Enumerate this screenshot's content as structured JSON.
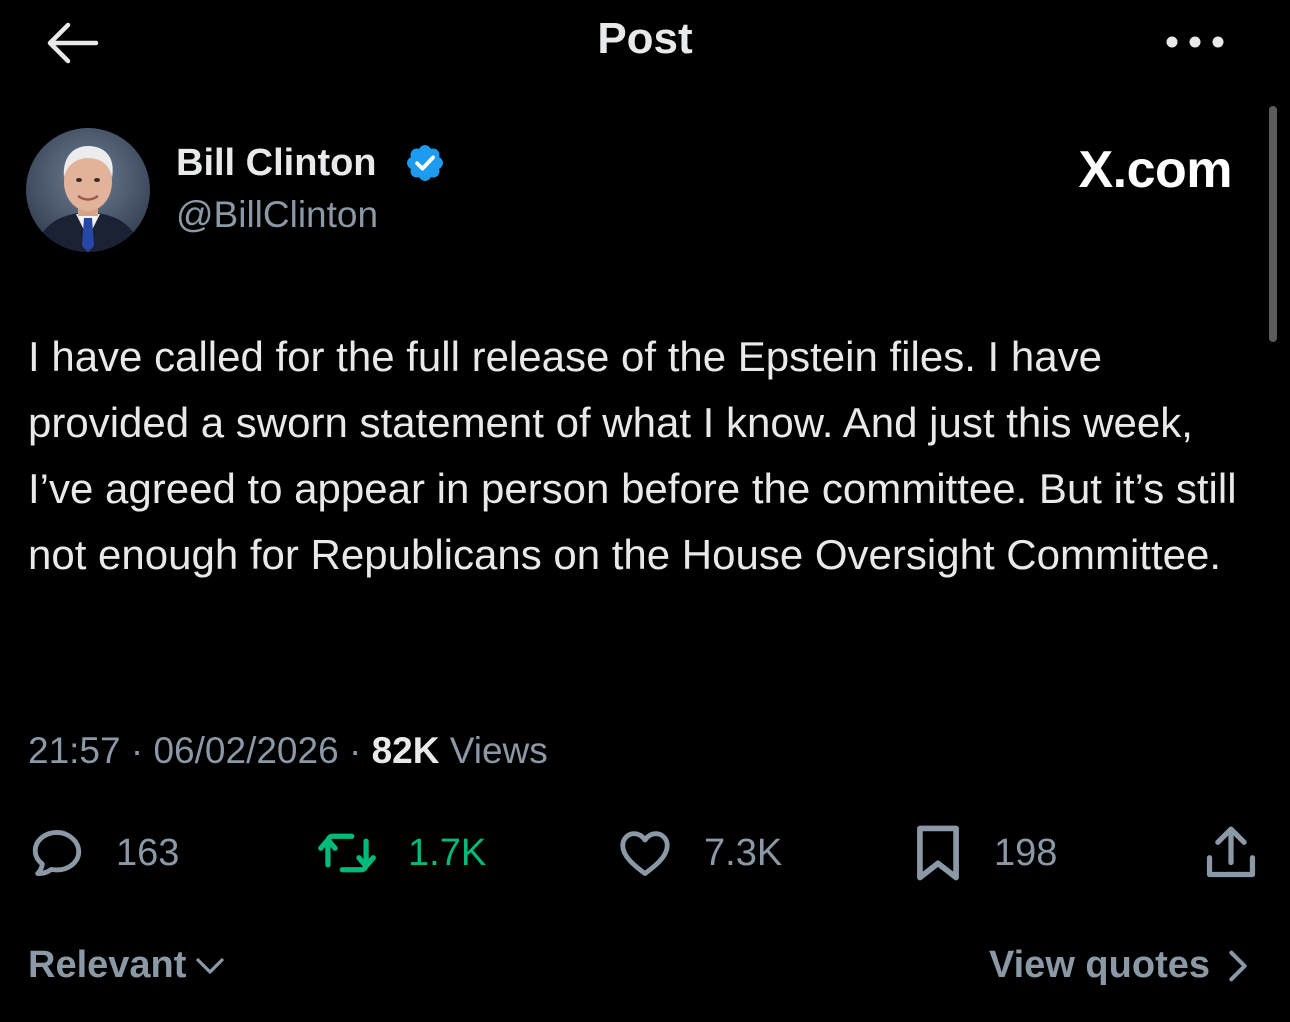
{
  "header": {
    "title": "Post",
    "back_icon": "arrow-left-icon",
    "more_icon": "more-horizontal-icon"
  },
  "author": {
    "name": "Bill Clinton",
    "handle": "@BillClinton",
    "verified_icon": "verified-badge-icon",
    "verified_color": "#1d9bf0"
  },
  "watermark": "X.com",
  "post": {
    "text": "I have called for the full release of the Epstein files. I have provided a sworn statement of what I know. And just this week, I’ve agreed to appear in person before the committee. But it’s still not enough for Republicans on the House Oversight Committee."
  },
  "meta": {
    "time": "21:57",
    "separator": "·",
    "date": "06/02/2026",
    "views_count": "82K",
    "views_label": "Views"
  },
  "actions": {
    "replies": "163",
    "reposts": "1.7K",
    "likes": "7.3K",
    "bookmarks": "198",
    "reposted_color": "#00ba7c"
  },
  "footer": {
    "sort_label": "Relevant",
    "quotes_label": "View quotes"
  }
}
